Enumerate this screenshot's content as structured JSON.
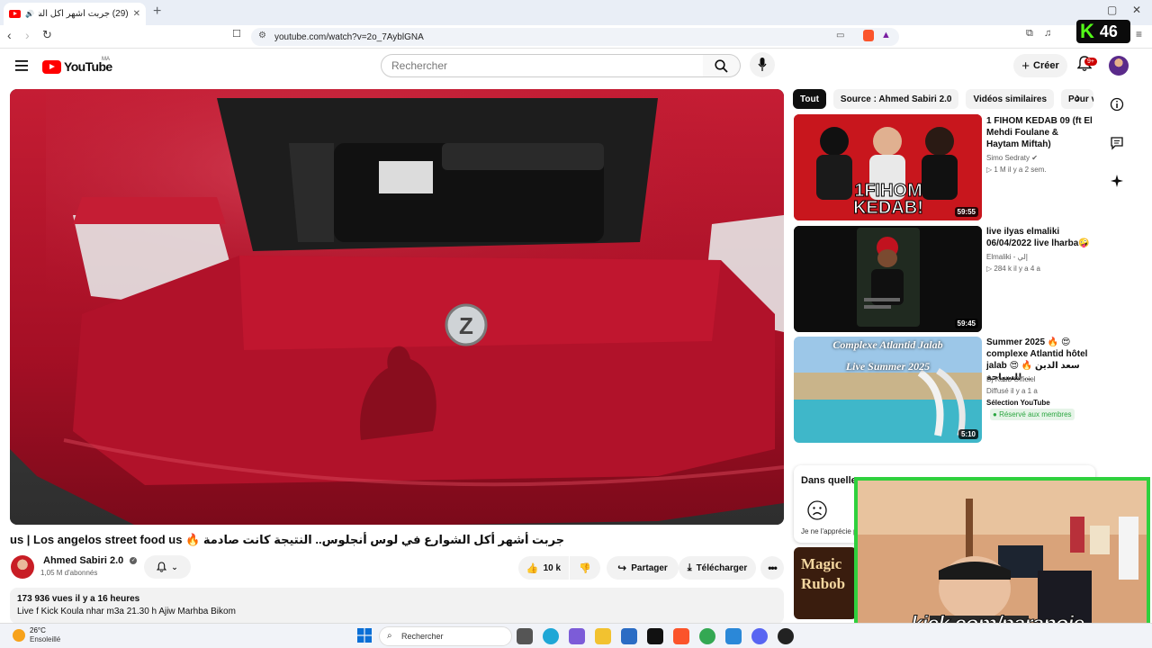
{
  "browser": {
    "tab_title": "(29) جربت أشهر أكل الشوارع ف...",
    "url": "youtube.com/watch?v=2o_7AyblGNA"
  },
  "header": {
    "logo_text": "YouTube",
    "country_code": "MA",
    "search_placeholder": "Rechercher",
    "create_label": "Créer",
    "notif_count": "9+"
  },
  "video": {
    "title": "جربت أشهر أكل الشوارع في لوس أنجلوس.. النتيجة كانت صادمة 🔥 us | Los angelos street food us",
    "channel": "Ahmed Sabiri 2.0",
    "subscribers": "1,05 M d'abonnés",
    "likes": "10 k",
    "share_label": "Partager",
    "download_label": "Télécharger",
    "views_line": "173 936 vues  il y a 16 heures",
    "description": "Live f Kick Koula nhar m3a 21.30 h Ajiw Marhba Bikom"
  },
  "chips": [
    "Tout",
    "Source : Ahmed Sabiri 2.0",
    "Vidéos similaires",
    "Pour vous"
  ],
  "recommendations": [
    {
      "title": "1 FIHOM KEDAB 09 (ft El Mehdi Foulane & Haytam Miftah)",
      "channel": "Simo Sedraty",
      "meta": "1 M  il y a 2 sem.",
      "duration": "59:55",
      "thumb_text": "1FIHOM KEDAB!"
    },
    {
      "title": "live ilyas elmaliki 06/04/2022 live lharba🤪",
      "channel": "Elmaliki - إلي",
      "meta": "284 k  il y a 4 a",
      "duration": "59:45"
    },
    {
      "title": "Summer 2025 🔥 😍 complexe Atlantid hôtel jalab 😍 🔥 سعد الدين للسياحة ...",
      "channel": "Dj Katib Officiel",
      "meta": "Diffusé il y a 1 a",
      "extra": "Sélection YouTube",
      "members": "Réservé aux membres",
      "duration": "5:10",
      "thumb_line1": "Complexe Atlantid Jalab",
      "thumb_line2": "Live Summer 2025"
    }
  ],
  "survey": {
    "question": "Dans quelle m",
    "option": "Je ne l'apprécie p"
  },
  "next_thumb_text": "Magic Rubob",
  "overlay": {
    "kick_url": "kick.com/paranoie",
    "kick_count": "46"
  },
  "taskbar": {
    "temperature": "26°C",
    "weather": "Ensoleillé",
    "search": "Rechercher"
  },
  "colors": {
    "youtube_red": "#ff0000",
    "kick_green": "#53fc18",
    "car_red": "#b1122a"
  }
}
